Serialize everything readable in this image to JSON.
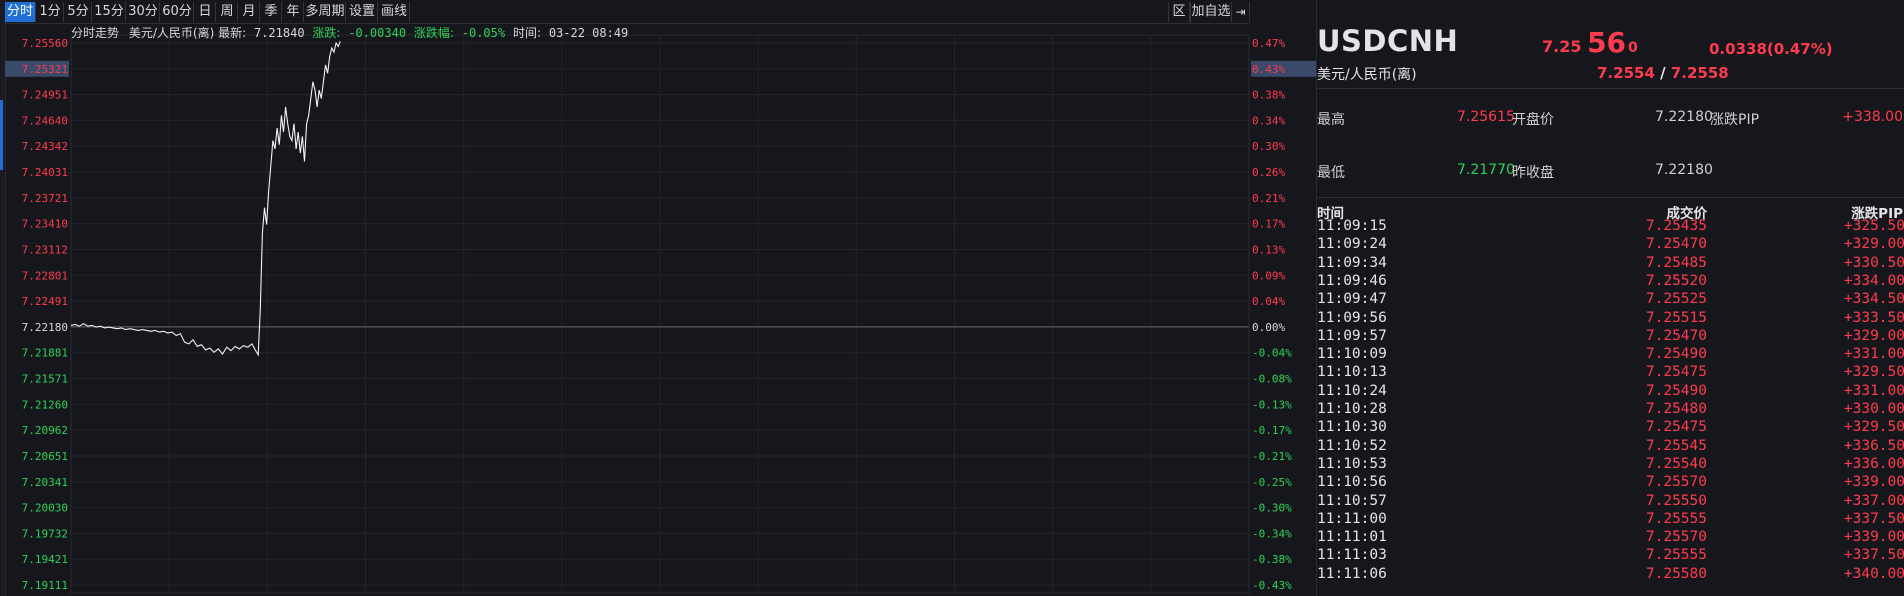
{
  "toolbar": {
    "periods": [
      "分时",
      "1分",
      "5分",
      "15分",
      "30分",
      "60分",
      "日",
      "周",
      "月",
      "季",
      "年",
      "多周期",
      "设置",
      "画线"
    ],
    "active_index": 0,
    "right_buttons": [
      "区",
      "加自选"
    ],
    "exit_icon": "exit-icon"
  },
  "info": {
    "title": "分时走势",
    "pair": "美元/人民币(离)",
    "latest_label": "最新:",
    "latest_value": "7.21840",
    "change_label": "涨跌:",
    "change_value": "-0.00340",
    "pct_label": "涨跌幅:",
    "pct_value": "-0.05%",
    "time_label": "时间:",
    "time_value": "03-22 08:49"
  },
  "colors": {
    "up": "#ff3b4e",
    "down": "#2ed158",
    "neutral": "#d8d8d8",
    "accent": "#1f6fd6",
    "background": "#16171c"
  },
  "chart_data": {
    "type": "line",
    "title": "",
    "base_price": 7.2218,
    "ylim": [
      7.19111,
      7.2556
    ],
    "y_ticks_left": [
      "7.25560",
      "7.25321",
      "7.24951",
      "7.24640",
      "7.24342",
      "7.24031",
      "7.23721",
      "7.23410",
      "7.23112",
      "7.22801",
      "7.22491",
      "7.22180",
      "7.21881",
      "7.21571",
      "7.21260",
      "7.20962",
      "7.20651",
      "7.20341",
      "7.20030",
      "7.19732",
      "7.19421",
      "7.19111"
    ],
    "y_ticks_right": [
      "0.47%",
      "0.43%",
      "0.38%",
      "0.34%",
      "0.30%",
      "0.26%",
      "0.21%",
      "0.17%",
      "0.13%",
      "0.09%",
      "0.04%",
      "0.00%",
      "-0.04%",
      "-0.08%",
      "-0.13%",
      "-0.17%",
      "-0.21%",
      "-0.25%",
      "-0.30%",
      "-0.34%",
      "-0.38%",
      "-0.43%"
    ],
    "highlight_price": "7.25321",
    "highlight_pct": "0.43%",
    "points": [
      [
        0,
        7.222
      ],
      [
        2,
        7.2221
      ],
      [
        4,
        7.2219
      ],
      [
        6,
        7.2222
      ],
      [
        8,
        7.2219
      ],
      [
        10,
        7.222
      ],
      [
        12,
        7.2218
      ],
      [
        14,
        7.2219
      ],
      [
        16,
        7.2217
      ],
      [
        18,
        7.2218
      ],
      [
        20,
        7.2217
      ],
      [
        22,
        7.2216
      ],
      [
        24,
        7.2217
      ],
      [
        26,
        7.2215
      ],
      [
        28,
        7.2216
      ],
      [
        30,
        7.2215
      ],
      [
        32,
        7.2214
      ],
      [
        34,
        7.2215
      ],
      [
        36,
        7.2214
      ],
      [
        38,
        7.2213
      ],
      [
        40,
        7.2214
      ],
      [
        42,
        7.2212
      ],
      [
        44,
        7.2213
      ],
      [
        46,
        7.2211
      ],
      [
        48,
        7.2212
      ],
      [
        50,
        7.2208
      ],
      [
        52,
        7.221
      ],
      [
        54,
        7.22
      ],
      [
        56,
        7.2198
      ],
      [
        58,
        7.2203
      ],
      [
        60,
        7.2195
      ],
      [
        62,
        7.2197
      ],
      [
        64,
        7.2191
      ],
      [
        66,
        7.2193
      ],
      [
        68,
        7.2188
      ],
      [
        70,
        7.2192
      ],
      [
        72,
        7.2186
      ],
      [
        74,
        7.2194
      ],
      [
        76,
        7.219
      ],
      [
        78,
        7.2195
      ],
      [
        80,
        7.2192
      ],
      [
        82,
        7.2196
      ],
      [
        84,
        7.2194
      ],
      [
        86,
        7.2198
      ],
      [
        88,
        7.2189
      ],
      [
        89,
        7.2185
      ],
      [
        90,
        7.224
      ],
      [
        91,
        7.233
      ],
      [
        92,
        7.236
      ],
      [
        93,
        7.234
      ],
      [
        94,
        7.238
      ],
      [
        95,
        7.241
      ],
      [
        96,
        7.244
      ],
      [
        97,
        7.243
      ],
      [
        98,
        7.2455
      ],
      [
        99,
        7.2435
      ],
      [
        100,
        7.247
      ],
      [
        101,
        7.245
      ],
      [
        102,
        7.248
      ],
      [
        103,
        7.246
      ],
      [
        104,
        7.2445
      ],
      [
        105,
        7.244
      ],
      [
        106,
        7.246
      ],
      [
        107,
        7.243
      ],
      [
        108,
        7.245
      ],
      [
        109,
        7.2425
      ],
      [
        110,
        7.2445
      ],
      [
        111,
        7.2415
      ],
      [
        112,
        7.246
      ],
      [
        113,
        7.247
      ],
      [
        114,
        7.249
      ],
      [
        115,
        7.251
      ],
      [
        116,
        7.25
      ],
      [
        117,
        7.248
      ],
      [
        118,
        7.25
      ],
      [
        119,
        7.249
      ],
      [
        120,
        7.251
      ],
      [
        121,
        7.253
      ],
      [
        122,
        7.252
      ],
      [
        123,
        7.254
      ],
      [
        124,
        7.255
      ],
      [
        125,
        7.2545
      ],
      [
        126,
        7.2556
      ],
      [
        127,
        7.2552
      ],
      [
        128,
        7.2558
      ]
    ],
    "x_total": 560
  },
  "quote": {
    "symbol": "USDCNH",
    "name": "美元/人民币(离)",
    "price_prefix": "7.25",
    "price_big": "56",
    "price_small": "0",
    "change": "0.0338(0.47%)",
    "bid": "7.2554",
    "bid_ask_sep": "/",
    "ask": "7.2558",
    "high_label": "最高",
    "high_value": "7.25615",
    "open_label": "开盘价",
    "open_value": "7.22180",
    "pip_label": "涨跌PIP",
    "pip_value": "+338.00",
    "low_label": "最低",
    "low_value": "7.21770",
    "prev_close_label": "昨收盘",
    "prev_close_value": "7.22180"
  },
  "trades": {
    "headers": [
      "时间",
      "成交价",
      "涨跌PIP"
    ],
    "rows": [
      [
        "11:09:15",
        "7.25435",
        "+325.50"
      ],
      [
        "11:09:24",
        "7.25470",
        "+329.00"
      ],
      [
        "11:09:34",
        "7.25485",
        "+330.50"
      ],
      [
        "11:09:46",
        "7.25520",
        "+334.00"
      ],
      [
        "11:09:47",
        "7.25525",
        "+334.50"
      ],
      [
        "11:09:56",
        "7.25515",
        "+333.50"
      ],
      [
        "11:09:57",
        "7.25470",
        "+329.00"
      ],
      [
        "11:10:09",
        "7.25490",
        "+331.00"
      ],
      [
        "11:10:13",
        "7.25475",
        "+329.50"
      ],
      [
        "11:10:24",
        "7.25490",
        "+331.00"
      ],
      [
        "11:10:28",
        "7.25480",
        "+330.00"
      ],
      [
        "11:10:30",
        "7.25475",
        "+329.50"
      ],
      [
        "11:10:52",
        "7.25545",
        "+336.50"
      ],
      [
        "11:10:53",
        "7.25540",
        "+336.00"
      ],
      [
        "11:10:56",
        "7.25570",
        "+339.00"
      ],
      [
        "11:10:57",
        "7.25550",
        "+337.00"
      ],
      [
        "11:11:00",
        "7.25555",
        "+337.50"
      ],
      [
        "11:11:01",
        "7.25570",
        "+339.00"
      ],
      [
        "11:11:03",
        "7.25555",
        "+337.50"
      ],
      [
        "11:11:06",
        "7.25580",
        "+340.00"
      ]
    ]
  }
}
